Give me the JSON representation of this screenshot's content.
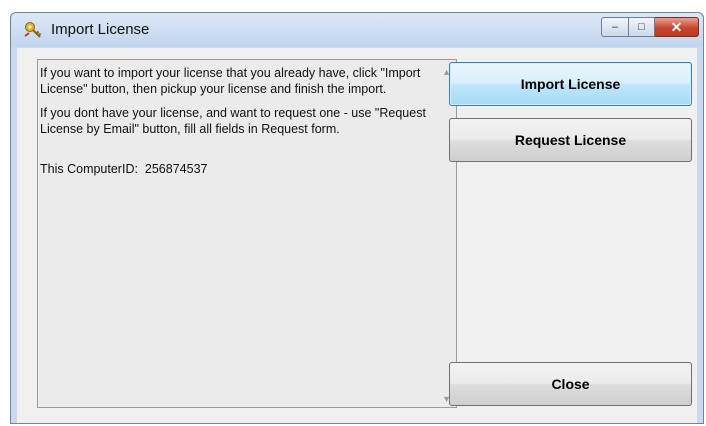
{
  "window": {
    "title": "Import License",
    "icon": "key-license-icon"
  },
  "caption_buttons": {
    "minimize": "–",
    "maximize": "□",
    "close": "✕"
  },
  "info": {
    "paragraph1": "If you want to import your license that you already have, click \"Import License\" button, then pickup your license and finish the import.",
    "paragraph2": "If you dont have your license, and want to request one - use \"Request License by Email\" button, fill all fields in Request form.",
    "computer_id_label": "This ComputerID:",
    "computer_id_value": "256874537"
  },
  "buttons": {
    "import_label": "Import License",
    "request_label": "Request License",
    "close_label": "Close"
  }
}
